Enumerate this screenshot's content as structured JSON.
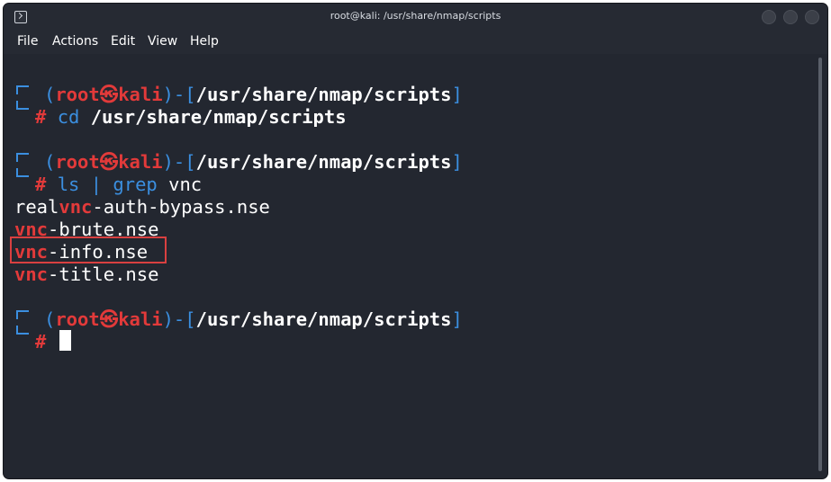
{
  "window": {
    "title": "root@kali: /usr/share/nmap/scripts",
    "icon": "terminal-icon"
  },
  "menu": {
    "items": [
      "File",
      "Actions",
      "Edit",
      "View",
      "Help"
    ]
  },
  "prompt": {
    "open_paren": "(",
    "user": "root",
    "at_symbol": "㉿",
    "host": "kali",
    "close_paren_dash": ")-[",
    "path": "/usr/share/nmap/scripts",
    "close_bracket": "]",
    "hash": "#"
  },
  "commands": [
    {
      "cmd": "cd",
      "args": "/usr/share/nmap/scripts"
    },
    {
      "cmd": "ls | grep",
      "args": "vnc"
    }
  ],
  "output": [
    {
      "prefix": "real",
      "match": "vnc",
      "suffix": "-auth-bypass.nse"
    },
    {
      "prefix": "",
      "match": "vnc",
      "suffix": "-brute.nse"
    },
    {
      "prefix": "",
      "match": "vnc",
      "suffix": "-info.nse",
      "highlighted": true
    },
    {
      "prefix": "",
      "match": "vnc",
      "suffix": "-title.nse"
    }
  ],
  "colors": {
    "background": "#232730",
    "prompt_blue": "#3b8fe0",
    "prompt_red": "#e23a3a",
    "highlight_box": "#d94040"
  }
}
